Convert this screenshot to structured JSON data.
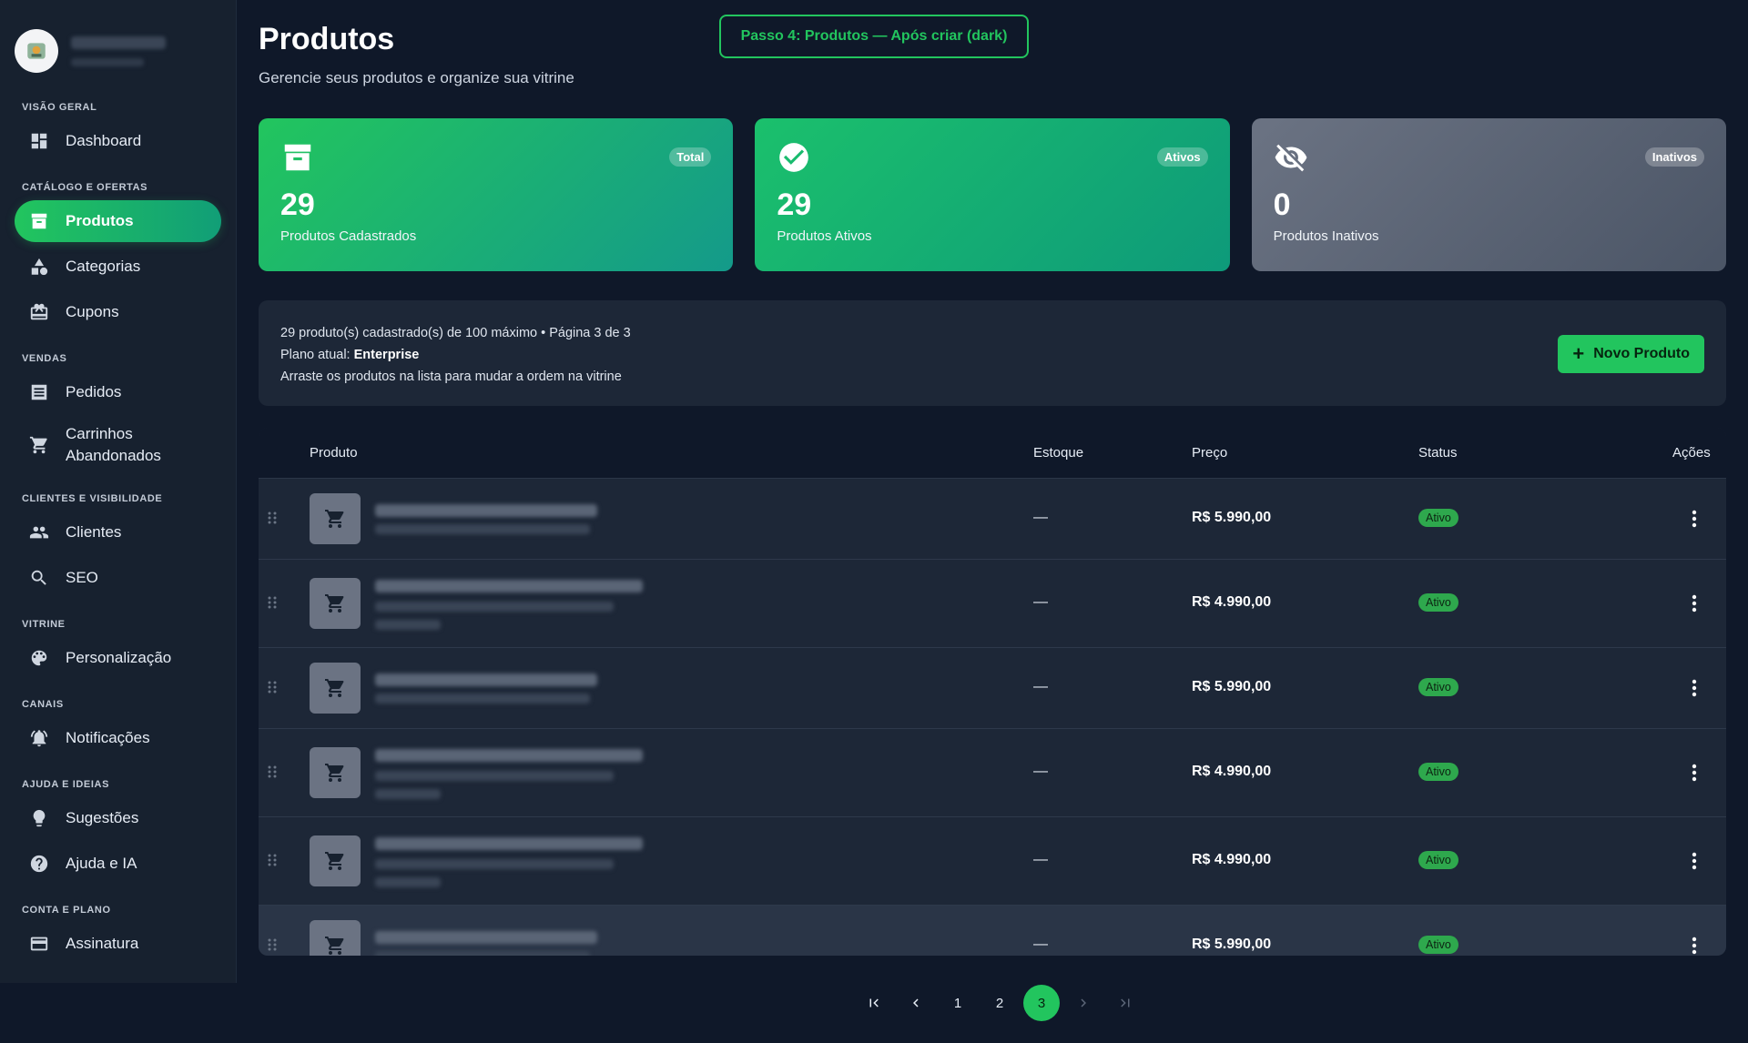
{
  "brand": {
    "logo_icon": "store-logo-icon"
  },
  "sidebar": {
    "sections": [
      {
        "title": "VISÃO GERAL"
      },
      {
        "title": "CATÁLOGO E OFERTAS"
      },
      {
        "title": "VENDAS"
      },
      {
        "title": "CLIENTES E VISIBILIDADE"
      },
      {
        "title": "VITRINE"
      },
      {
        "title": "CANAIS"
      },
      {
        "title": "AJUDA E IDEIAS"
      },
      {
        "title": "CONTA E PLANO"
      }
    ],
    "items": [
      {
        "label": "Dashboard",
        "icon": "dashboard-icon"
      },
      {
        "label": "Produtos",
        "icon": "archive-icon",
        "active": true
      },
      {
        "label": "Categorias",
        "icon": "shapes-icon"
      },
      {
        "label": "Cupons",
        "icon": "ticket-icon"
      },
      {
        "label": "Pedidos",
        "icon": "list-icon"
      },
      {
        "label": "Carrinhos Abandonados",
        "icon": "cart-icon"
      },
      {
        "label": "Clientes",
        "icon": "people-icon"
      },
      {
        "label": "SEO",
        "icon": "search-icon"
      },
      {
        "label": "Personalização",
        "icon": "palette-icon"
      },
      {
        "label": "Notificações",
        "icon": "bell-icon"
      },
      {
        "label": "Sugestões",
        "icon": "lightbulb-icon"
      },
      {
        "label": "Ajuda e IA",
        "icon": "help-icon"
      },
      {
        "label": "Assinatura",
        "icon": "card-icon"
      }
    ]
  },
  "header": {
    "title": "Produtos",
    "subtitle": "Gerencie seus produtos e organize sua vitrine",
    "step_label": "Passo 4: Produtos — Após criar (dark)"
  },
  "stats": [
    {
      "badge": "Total",
      "value": "29",
      "label": "Produtos Cadastrados",
      "icon": "archive-icon"
    },
    {
      "badge": "Ativos",
      "value": "29",
      "label": "Produtos Ativos",
      "icon": "check-circle-icon"
    },
    {
      "badge": "Inativos",
      "value": "0",
      "label": "Produtos Inativos",
      "icon": "eye-off-icon"
    }
  ],
  "info": {
    "line1": "29 produto(s) cadastrado(s) de 100 máximo • Página 3 de 3",
    "plan_prefix": "Plano atual: ",
    "plan_name": "Enterprise",
    "line3": "Arraste os produtos na lista para mudar a ordem na vitrine",
    "new_button": "Novo Produto"
  },
  "table": {
    "columns": [
      "Produto",
      "Estoque",
      "Preço",
      "Status",
      "Ações"
    ],
    "rows": [
      {
        "stock": "—",
        "price": "R$ 5.990,00",
        "status": "Ativo"
      },
      {
        "stock": "—",
        "price": "R$ 4.990,00",
        "status": "Ativo"
      },
      {
        "stock": "—",
        "price": "R$ 5.990,00",
        "status": "Ativo"
      },
      {
        "stock": "—",
        "price": "R$ 4.990,00",
        "status": "Ativo"
      },
      {
        "stock": "—",
        "price": "R$ 4.990,00",
        "status": "Ativo"
      },
      {
        "stock": "—",
        "price": "R$ 5.990,00",
        "status": "Ativo"
      }
    ]
  },
  "pagination": {
    "pages": [
      "1",
      "2",
      "3"
    ],
    "current": "3"
  },
  "colors": {
    "accent": "#22c55e",
    "background": "#0f1829",
    "sidebar": "#17212f",
    "surface": "#1d2737"
  }
}
